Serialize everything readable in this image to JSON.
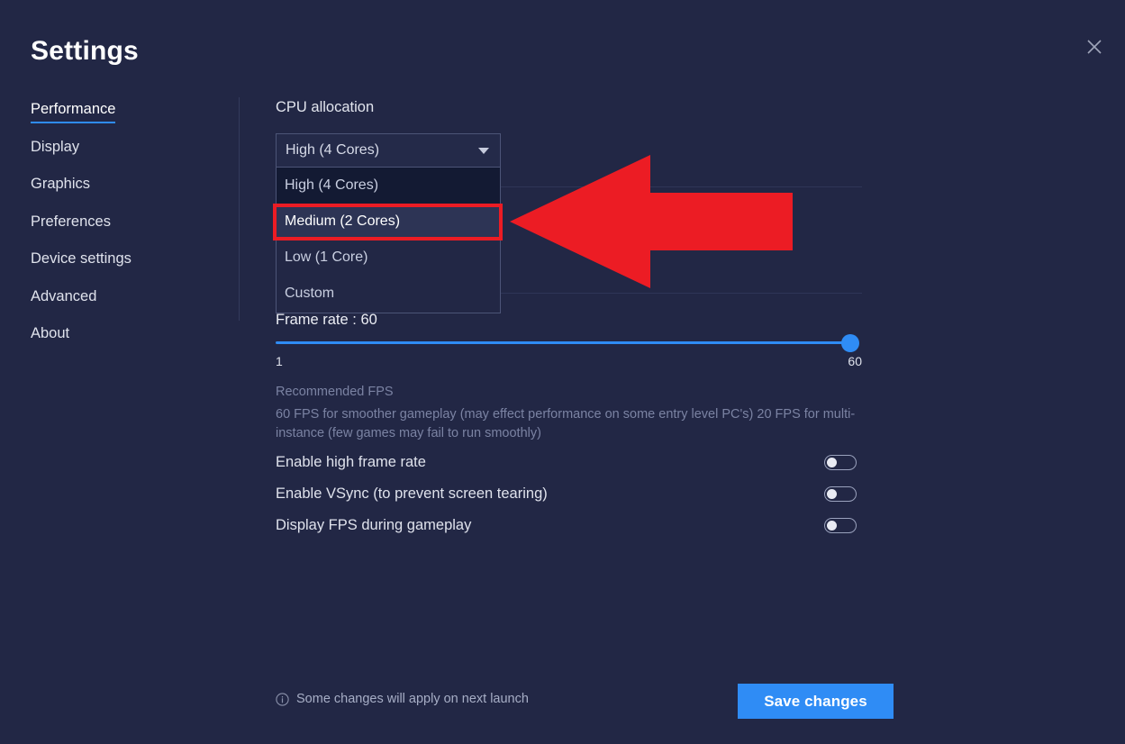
{
  "window": {
    "title": "Settings",
    "close_icon": "close-icon",
    "background": "#222745",
    "accent": "#2f8cf5",
    "annotation_color": "#ec1c24"
  },
  "sidebar": {
    "items": [
      {
        "label": "Performance",
        "active": true
      },
      {
        "label": "Display",
        "active": false
      },
      {
        "label": "Graphics",
        "active": false
      },
      {
        "label": "Preferences",
        "active": false
      },
      {
        "label": "Device settings",
        "active": false
      },
      {
        "label": "Advanced",
        "active": false
      },
      {
        "label": "About",
        "active": false
      }
    ]
  },
  "content": {
    "cpu": {
      "label": "CPU allocation",
      "selected": "High (4 Cores)",
      "caret_icon": "chevron-down-icon",
      "open": true,
      "options": [
        {
          "label": "High (4 Cores)",
          "state": "selected"
        },
        {
          "label": "Medium (2 Cores)",
          "state": "highlighted"
        },
        {
          "label": "Low (1 Core)",
          "state": "normal"
        },
        {
          "label": "Custom",
          "state": "normal"
        }
      ]
    },
    "frame_rate": {
      "label": "Frame rate : 60",
      "value": 60,
      "min_label": "1",
      "max_label": "60",
      "min": 1,
      "max": 60,
      "recommended_title": "Recommended FPS",
      "recommended_desc": "60 FPS for smoother gameplay (may effect performance on some entry level PC's) 20 FPS for multi-instance (few games may fail to run smoothly)"
    },
    "toggles": [
      {
        "label": "Enable high frame rate",
        "on": false
      },
      {
        "label": "Enable VSync (to prevent screen tearing)",
        "on": false
      },
      {
        "label": "Display FPS during gameplay",
        "on": false
      }
    ]
  },
  "footer": {
    "info_icon": "info-icon",
    "note": "Some changes will apply on next launch",
    "save_label": "Save changes"
  },
  "annotation": {
    "arrow_icon": "left-arrow-annotation",
    "target": "Medium (2 Cores)"
  }
}
